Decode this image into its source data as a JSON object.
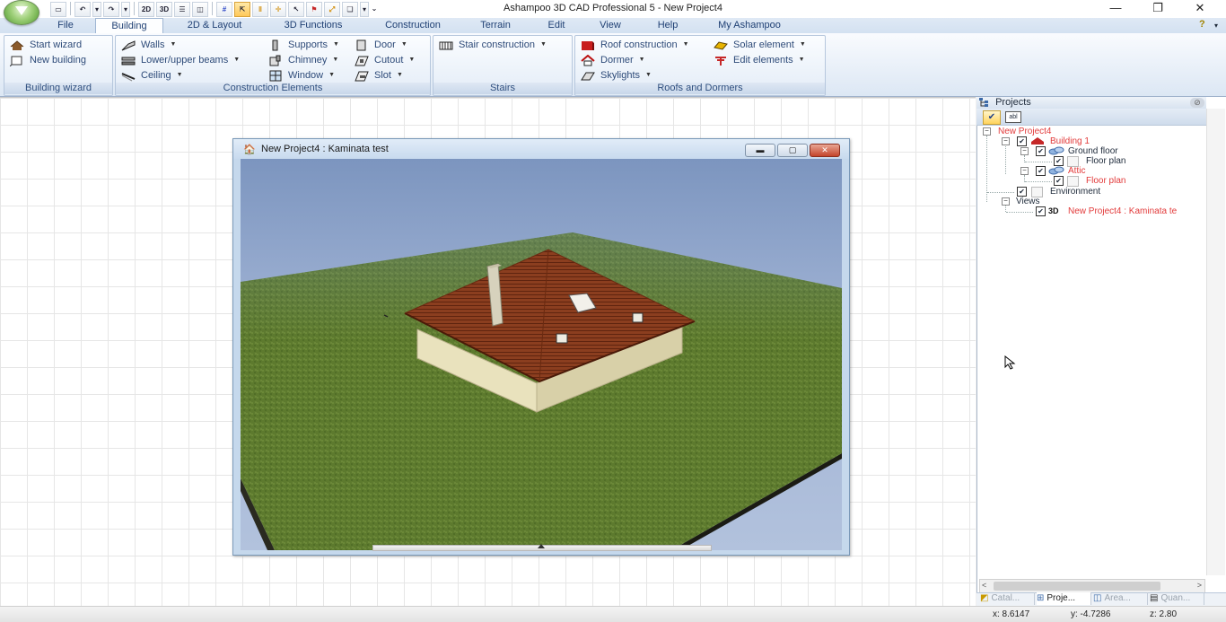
{
  "window": {
    "title": "Ashampoo 3D CAD Professional 5 - New Project4",
    "minimize_glyph": "—",
    "restore_glyph": "❐",
    "close_glyph": "✕"
  },
  "quick_access": {
    "label_2d": "2D",
    "label_3d": "3D"
  },
  "ribbon": {
    "tabs": [
      {
        "label": "File"
      },
      {
        "label": "Building"
      },
      {
        "label": "2D & Layout"
      },
      {
        "label": "3D Functions"
      },
      {
        "label": "Construction"
      },
      {
        "label": "Terrain"
      },
      {
        "label": "Edit"
      },
      {
        "label": "View"
      },
      {
        "label": "Help"
      },
      {
        "label": "My Ashampoo"
      }
    ],
    "groups": {
      "building_wizard": {
        "label": "Building wizard",
        "items": [
          "Start wizard",
          "New building"
        ]
      },
      "construction_elements": {
        "label": "Construction Elements",
        "items": [
          "Walls",
          "Lower/upper beams",
          "Ceiling",
          "Supports",
          "Chimney",
          "Window",
          "Door",
          "Cutout",
          "Slot"
        ]
      },
      "stairs": {
        "label": "Stairs",
        "items": [
          "Stair construction"
        ]
      },
      "roofs_dormers": {
        "label": "Roofs and Dormers",
        "items": [
          "Roof construction",
          "Dormer",
          "Skylights",
          "Solar element",
          "Edit elements"
        ]
      }
    }
  },
  "child_window": {
    "title": "New Project4 : Kaminata test"
  },
  "projects_panel": {
    "header": "Projects",
    "toolbar_abl": "abl",
    "tree": [
      {
        "label": "New Project4"
      },
      {
        "label": "Building 1"
      },
      {
        "label": "Ground floor"
      },
      {
        "label": "Floor plan"
      },
      {
        "label": "Attic"
      },
      {
        "label": "Floor plan"
      },
      {
        "label": "Environment"
      },
      {
        "label": "Views"
      },
      {
        "label": "New Project4 : Kaminata te"
      }
    ],
    "view_badge": "3D",
    "bottom_tabs": [
      {
        "label": "Catal..."
      },
      {
        "label": "Proje..."
      },
      {
        "label": "Area..."
      },
      {
        "label": "Quan..."
      }
    ]
  },
  "status": {
    "x": "x: 8.6147",
    "y": "y: -4.7286",
    "z": "z: 2.80"
  },
  "colors": {
    "ribbon_text": "#2d4a78",
    "tree_highlight": "#e23a3a",
    "grass": "#5d7a2e",
    "roof": "#8b3e1f",
    "walls": "#e9e2bd"
  }
}
